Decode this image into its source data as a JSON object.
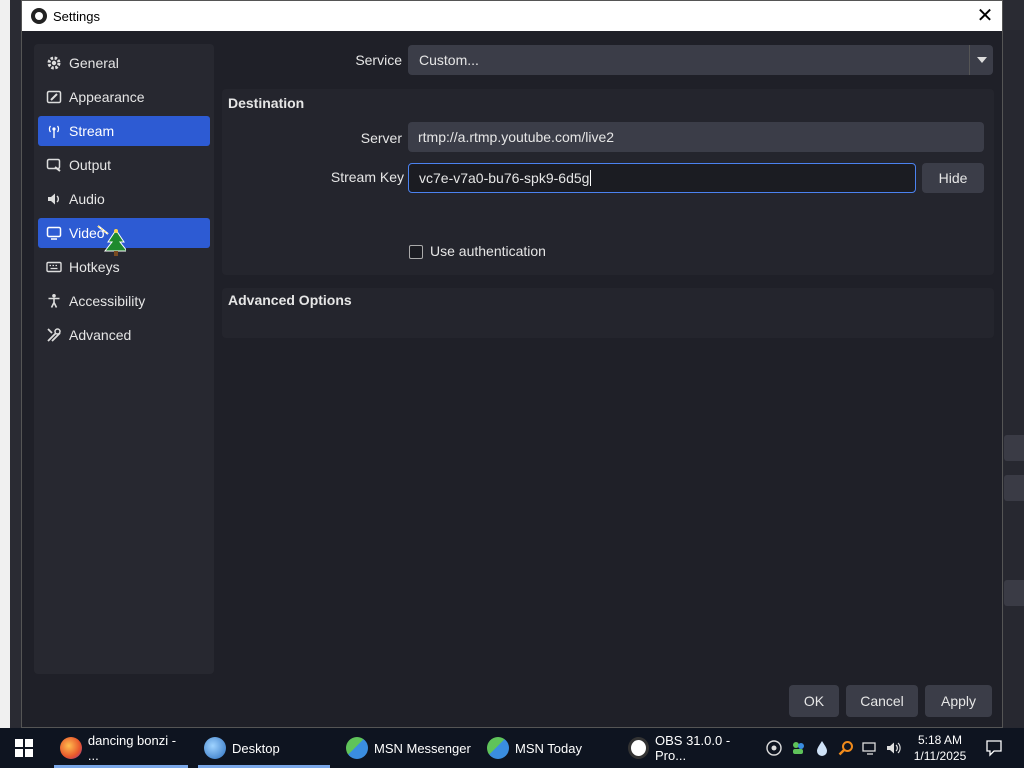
{
  "window": {
    "title": "Settings"
  },
  "sidebar": {
    "items": [
      {
        "label": "General",
        "icon": "gear-icon",
        "active": false
      },
      {
        "label": "Appearance",
        "icon": "appearance-icon",
        "active": false
      },
      {
        "label": "Stream",
        "icon": "antenna-icon",
        "active": true
      },
      {
        "label": "Output",
        "icon": "output-icon",
        "active": false
      },
      {
        "label": "Audio",
        "icon": "speaker-icon",
        "active": false
      },
      {
        "label": "Video",
        "icon": "monitor-icon",
        "active": true
      },
      {
        "label": "Hotkeys",
        "icon": "keyboard-icon",
        "active": false
      },
      {
        "label": "Accessibility",
        "icon": "accessibility-icon",
        "active": false
      },
      {
        "label": "Advanced",
        "icon": "tools-icon",
        "active": false
      }
    ]
  },
  "service": {
    "label": "Service",
    "value": "Custom..."
  },
  "destination": {
    "title": "Destination",
    "server_label": "Server",
    "server_value": "rtmp://a.rtmp.youtube.com/live2",
    "key_label": "Stream Key",
    "key_help": "?",
    "key_value": "vc7e-v7a0-bu76-spk9-6d5g",
    "hide_label": "Hide",
    "auth_label": "Use authentication"
  },
  "advanced": {
    "title": "Advanced Options"
  },
  "footer": {
    "ok": "OK",
    "cancel": "Cancel",
    "apply": "Apply"
  },
  "taskbar": {
    "tasks": [
      {
        "label": "dancing bonzi - ...",
        "icon": "firefox-icon"
      },
      {
        "label": "Desktop",
        "icon": "desktop-icon"
      },
      {
        "label": "MSN Messenger",
        "icon": "msn-messenger-icon"
      },
      {
        "label": "MSN Today",
        "icon": "msn-today-icon"
      },
      {
        "label": "OBS 31.0.0 - Pro...",
        "icon": "obs-icon"
      }
    ],
    "time": "5:18 AM",
    "date": "1/11/2025"
  },
  "colors": {
    "accent": "#2d5bd3",
    "background": "#1f2028",
    "field": "#3b3d48",
    "focus": "#4b82f0"
  }
}
